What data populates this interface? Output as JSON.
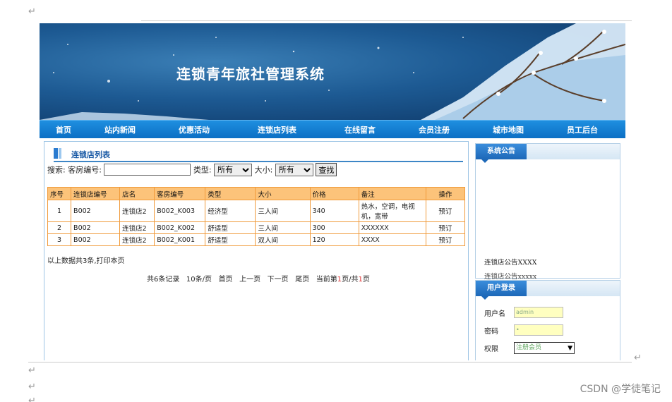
{
  "para_marks": {
    "mark": "↵"
  },
  "banner": {
    "title": "连锁青年旅社管理系统"
  },
  "nav": {
    "items": [
      "首页",
      "站内新闻",
      "优惠活动",
      "连锁店列表",
      "在线留言",
      "会员注册",
      "城市地图",
      "员工后台"
    ]
  },
  "panel": {
    "title": "连锁店列表"
  },
  "search": {
    "label": "搜索:",
    "room_no_label": "客房编号:",
    "room_no_value": "",
    "type_label": "类型:",
    "type_selected": "所有",
    "size_label": "大小:",
    "size_selected": "所有",
    "button": "查找"
  },
  "table": {
    "headers": [
      "序号",
      "连锁店编号",
      "店名",
      "客房编号",
      "类型",
      "大小",
      "价格",
      "备注",
      "操作"
    ],
    "rows": [
      [
        "1",
        "B002",
        "连锁店2",
        "B002_K003",
        "经济型",
        "三人间",
        "340",
        "热水，空调，电视机，宽带",
        "预订"
      ],
      [
        "2",
        "B002",
        "连锁店2",
        "B002_K002",
        "舒适型",
        "三人间",
        "300",
        "XXXXXX",
        "预订"
      ],
      [
        "3",
        "B002",
        "连锁店2",
        "B002_K001",
        "舒适型",
        "双人间",
        "120",
        "XXXX",
        "预订"
      ]
    ]
  },
  "summary": "以上数据共3条,打印本页",
  "pager": {
    "total": "共6条记录",
    "per_page": "10条/页",
    "first": "首页",
    "prev": "上一页",
    "next": "下一页",
    "last": "尾页",
    "current_prefix": "当前第",
    "current_page": "1",
    "current_mid": "页/共",
    "total_pages": "1",
    "current_suffix": "页"
  },
  "notice_box": {
    "title": "系统公告",
    "item1": "连锁店公告XXXX",
    "item2": "连锁店公告xxxxx"
  },
  "login_box": {
    "title": "用户登录",
    "username_label": "用户名",
    "username_value": "admin",
    "password_label": "密码",
    "password_value": "•",
    "role_label": "权限",
    "role_selected": "注册会员"
  },
  "watermark": "CSDN @学徒笔记",
  "colors": {
    "nav": "#0b6fc4",
    "table_header": "#fcc37a",
    "table_border": "#f09a3a"
  }
}
